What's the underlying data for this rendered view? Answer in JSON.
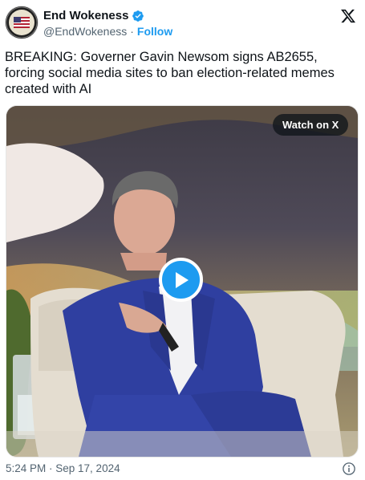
{
  "author": {
    "display_name": "End Wokeness",
    "handle": "@EndWokeness",
    "separator": "·",
    "follow_label": "Follow",
    "verified_color": "#1d9bf0"
  },
  "tweet": {
    "text": "BREAKING: Governer Gavin Newsom signs AB2655, forcing social media sites to ban election-related memes created with AI"
  },
  "media": {
    "watch_label": "Watch on X",
    "play_icon": "play-icon"
  },
  "footer": {
    "timestamp": "5:24 PM · Sep 17, 2024",
    "info_icon": "info-icon"
  },
  "colors": {
    "accent": "#1d9bf0",
    "text_primary": "#0f1419",
    "text_secondary": "#536471"
  }
}
